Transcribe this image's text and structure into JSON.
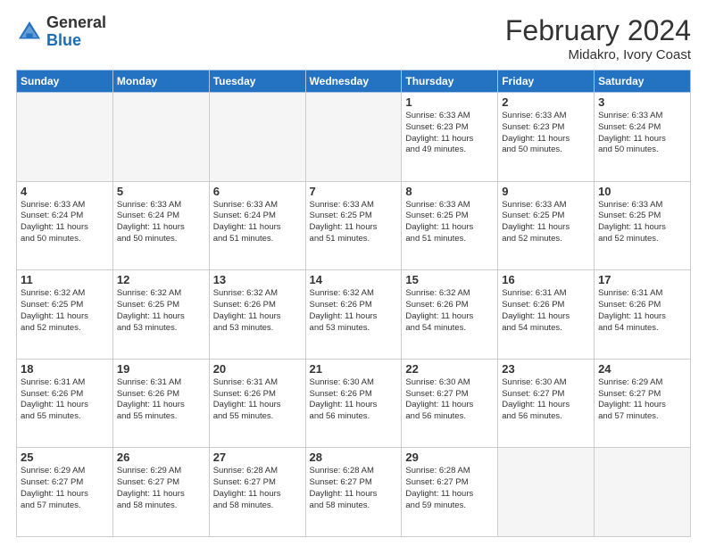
{
  "header": {
    "logo_general": "General",
    "logo_blue": "Blue",
    "month_title": "February 2024",
    "subtitle": "Midakro, Ivory Coast"
  },
  "days_of_week": [
    "Sunday",
    "Monday",
    "Tuesday",
    "Wednesday",
    "Thursday",
    "Friday",
    "Saturday"
  ],
  "weeks": [
    [
      {
        "day": "",
        "info": ""
      },
      {
        "day": "",
        "info": ""
      },
      {
        "day": "",
        "info": ""
      },
      {
        "day": "",
        "info": ""
      },
      {
        "day": "1",
        "info": "Sunrise: 6:33 AM\nSunset: 6:23 PM\nDaylight: 11 hours\nand 49 minutes."
      },
      {
        "day": "2",
        "info": "Sunrise: 6:33 AM\nSunset: 6:23 PM\nDaylight: 11 hours\nand 50 minutes."
      },
      {
        "day": "3",
        "info": "Sunrise: 6:33 AM\nSunset: 6:24 PM\nDaylight: 11 hours\nand 50 minutes."
      }
    ],
    [
      {
        "day": "4",
        "info": "Sunrise: 6:33 AM\nSunset: 6:24 PM\nDaylight: 11 hours\nand 50 minutes."
      },
      {
        "day": "5",
        "info": "Sunrise: 6:33 AM\nSunset: 6:24 PM\nDaylight: 11 hours\nand 50 minutes."
      },
      {
        "day": "6",
        "info": "Sunrise: 6:33 AM\nSunset: 6:24 PM\nDaylight: 11 hours\nand 51 minutes."
      },
      {
        "day": "7",
        "info": "Sunrise: 6:33 AM\nSunset: 6:25 PM\nDaylight: 11 hours\nand 51 minutes."
      },
      {
        "day": "8",
        "info": "Sunrise: 6:33 AM\nSunset: 6:25 PM\nDaylight: 11 hours\nand 51 minutes."
      },
      {
        "day": "9",
        "info": "Sunrise: 6:33 AM\nSunset: 6:25 PM\nDaylight: 11 hours\nand 52 minutes."
      },
      {
        "day": "10",
        "info": "Sunrise: 6:33 AM\nSunset: 6:25 PM\nDaylight: 11 hours\nand 52 minutes."
      }
    ],
    [
      {
        "day": "11",
        "info": "Sunrise: 6:32 AM\nSunset: 6:25 PM\nDaylight: 11 hours\nand 52 minutes."
      },
      {
        "day": "12",
        "info": "Sunrise: 6:32 AM\nSunset: 6:25 PM\nDaylight: 11 hours\nand 53 minutes."
      },
      {
        "day": "13",
        "info": "Sunrise: 6:32 AM\nSunset: 6:26 PM\nDaylight: 11 hours\nand 53 minutes."
      },
      {
        "day": "14",
        "info": "Sunrise: 6:32 AM\nSunset: 6:26 PM\nDaylight: 11 hours\nand 53 minutes."
      },
      {
        "day": "15",
        "info": "Sunrise: 6:32 AM\nSunset: 6:26 PM\nDaylight: 11 hours\nand 54 minutes."
      },
      {
        "day": "16",
        "info": "Sunrise: 6:31 AM\nSunset: 6:26 PM\nDaylight: 11 hours\nand 54 minutes."
      },
      {
        "day": "17",
        "info": "Sunrise: 6:31 AM\nSunset: 6:26 PM\nDaylight: 11 hours\nand 54 minutes."
      }
    ],
    [
      {
        "day": "18",
        "info": "Sunrise: 6:31 AM\nSunset: 6:26 PM\nDaylight: 11 hours\nand 55 minutes."
      },
      {
        "day": "19",
        "info": "Sunrise: 6:31 AM\nSunset: 6:26 PM\nDaylight: 11 hours\nand 55 minutes."
      },
      {
        "day": "20",
        "info": "Sunrise: 6:31 AM\nSunset: 6:26 PM\nDaylight: 11 hours\nand 55 minutes."
      },
      {
        "day": "21",
        "info": "Sunrise: 6:30 AM\nSunset: 6:26 PM\nDaylight: 11 hours\nand 56 minutes."
      },
      {
        "day": "22",
        "info": "Sunrise: 6:30 AM\nSunset: 6:27 PM\nDaylight: 11 hours\nand 56 minutes."
      },
      {
        "day": "23",
        "info": "Sunrise: 6:30 AM\nSunset: 6:27 PM\nDaylight: 11 hours\nand 56 minutes."
      },
      {
        "day": "24",
        "info": "Sunrise: 6:29 AM\nSunset: 6:27 PM\nDaylight: 11 hours\nand 57 minutes."
      }
    ],
    [
      {
        "day": "25",
        "info": "Sunrise: 6:29 AM\nSunset: 6:27 PM\nDaylight: 11 hours\nand 57 minutes."
      },
      {
        "day": "26",
        "info": "Sunrise: 6:29 AM\nSunset: 6:27 PM\nDaylight: 11 hours\nand 58 minutes."
      },
      {
        "day": "27",
        "info": "Sunrise: 6:28 AM\nSunset: 6:27 PM\nDaylight: 11 hours\nand 58 minutes."
      },
      {
        "day": "28",
        "info": "Sunrise: 6:28 AM\nSunset: 6:27 PM\nDaylight: 11 hours\nand 58 minutes."
      },
      {
        "day": "29",
        "info": "Sunrise: 6:28 AM\nSunset: 6:27 PM\nDaylight: 11 hours\nand 59 minutes."
      },
      {
        "day": "",
        "info": ""
      },
      {
        "day": "",
        "info": ""
      }
    ]
  ]
}
